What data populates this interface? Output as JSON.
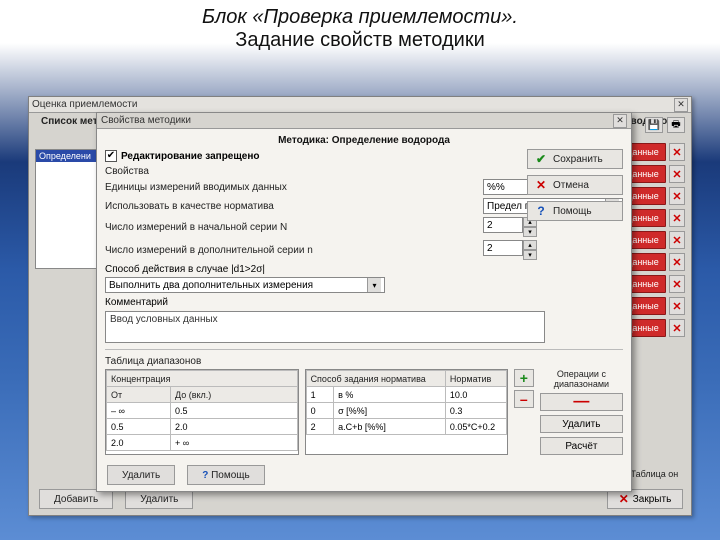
{
  "slide": {
    "line1": "Блок «Проверка приемлемости».",
    "line2": "Задание свойств методики"
  },
  "outer": {
    "title": "Оценка приемлемости",
    "list_header": "Список методик",
    "def_header": "Определение водорода",
    "white_item": "Определени",
    "data_btn": "Данные",
    "add": "Добавить",
    "delete": "Удалить",
    "close": "Закрыть",
    "table_caption": "7 Таблица он",
    "save_icon": "save-icon",
    "print_icon": "print-icon"
  },
  "dialog": {
    "title": "Свойства методики",
    "method_prefix": "Методика:",
    "method_name": "Определение водорода",
    "lock_label": "Редактирование запрещено",
    "group": "Свойства",
    "fields": {
      "units": "Единицы измерений вводимых данных",
      "units_val": "%%",
      "norm": "Использовать в качестве норматива",
      "norm_val": "Предел повторяемости r",
      "countN": "Число измерений в начальной серии N",
      "countN_val": "2",
      "countExtra": "Число измерений в дополнительной серии n",
      "countExtra_val": "2",
      "action": "Способ действия в случае |d1>2σ|",
      "action_val": "Выполнить два дополнительных измерения",
      "comment": "Комментарий",
      "comment_val": "Ввод условных данных"
    },
    "btns": {
      "save": "Сохранить",
      "cancel": "Отмена",
      "help": "Помощь"
    },
    "tables": {
      "ranges_caption": "Таблица диапазонов",
      "conc_header": "Концентрация",
      "from": "От",
      "to": "До (вкл.)",
      "norm_mode": "Способ задания норматива",
      "norm_col": "Норматив",
      "ops": "Операции с диапазонами",
      "del": "Удалить",
      "calc": "Расчёт",
      "rows": [
        {
          "from": "– ∞",
          "to": "0.5",
          "mode": "1",
          "fmt": "в %",
          "val": "10.0"
        },
        {
          "from": "0.5",
          "to": "2.0",
          "mode": "0",
          "fmt": "σ [%%]",
          "val": "0.3"
        },
        {
          "from": "2.0",
          "to": "+ ∞",
          "mode": "2",
          "fmt": "a.C+b [%%]",
          "val": "0.05*C+0.2"
        }
      ]
    },
    "footer": {
      "delete": "Удалить",
      "help": "Помощь"
    }
  }
}
